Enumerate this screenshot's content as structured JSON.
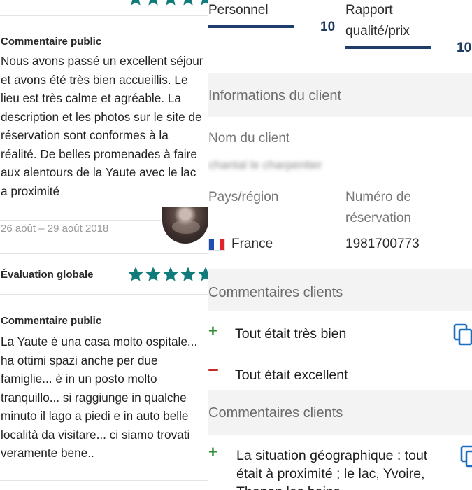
{
  "left": {
    "review1": {
      "label": "Commentaire public",
      "text": "Nous avons passé un excellent séjour et avons été très bien accueillis. Le lieu est très calme et agréable. La description et les photos sur le site de réservation sont conformes à la réalité. De belles promenades à faire aux alentours de la Yaute avec le lac a proximité",
      "dates": "26 août – 29 août 2018"
    },
    "overall": {
      "label": "Évaluation globale",
      "stars": 5
    },
    "review2": {
      "label": "Commentaire public",
      "text": "La Yaute è una casa molto ospitale... ha ottimi spazi anche per due famiglie... è in un posto molto tranquillo... si raggiunge in qualche minuto il lago a piedi e in auto belle località da visitare... ci siamo trovati veramente bene.."
    },
    "star_color": "#117a7a"
  },
  "right": {
    "ratings": [
      {
        "name": "Personnel",
        "score": "10"
      },
      {
        "name": "Rapport qualité/prix",
        "score": "10"
      }
    ],
    "client_info_title": "Informations du client",
    "client_name_label": "Nom du client",
    "client_name_value": "chantal le charpentier",
    "country_label": "Pays/région",
    "country_value": "France",
    "booking_label": "Numéro de réservation",
    "booking_value": "1981700773",
    "comments_title_1": "Commentaires clients",
    "positive_1": "Tout était très bien",
    "negative_1": "Tout était excellent",
    "comments_title_2": "Commentaires clients",
    "positive_2": "La situation géographique : tout était à proximité ; le lac, Yvoire, Thonon les bains"
  }
}
